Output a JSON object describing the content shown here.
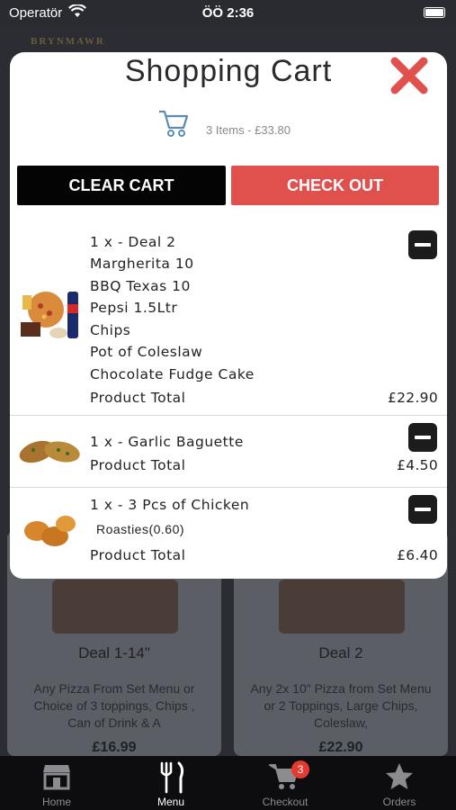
{
  "status_bar": {
    "carrier": "Operatör",
    "time": "ÖÖ 2:36"
  },
  "background": {
    "logo_text": "BRYNMAWR",
    "cards": [
      {
        "title": "Deal 1-14\"",
        "description": "Any Pizza From Set Menu or Choice of 3 toppings, Chips , Can of Drink & A",
        "price": "£16.99"
      },
      {
        "title": "Deal 2",
        "description": "Any 2x 10\" Pizza from Set Menu or 2 Toppings, Large Chips, Coleslaw,",
        "price": "£22.90"
      }
    ]
  },
  "cart": {
    "title": "Shopping Cart",
    "summary": "3 Items - £33.80",
    "clear_label": "CLEAR CART",
    "checkout_label": "CHECK OUT",
    "total_label": "Product Total",
    "items": [
      {
        "lines": [
          "1 x - Deal 2",
          "Margherita 10",
          "BBQ Texas 10",
          "Pepsi 1.5Ltr",
          "Chips",
          "Pot of Coleslaw",
          "Chocolate Fudge Cake"
        ],
        "total": "£22.90"
      },
      {
        "lines": [
          "1 x - Garlic Baguette"
        ],
        "total": "£4.50"
      },
      {
        "lines": [
          "1 x - 3 Pcs of Chicken",
          "Roasties(0.60)"
        ],
        "total": "£6.40"
      }
    ]
  },
  "tabs": [
    {
      "label": "Home",
      "icon": "store-icon"
    },
    {
      "label": "Menu",
      "icon": "fork-knife-icon"
    },
    {
      "label": "Checkout",
      "icon": "cart-icon",
      "badge": "3"
    },
    {
      "label": "Orders",
      "icon": "star-icon"
    }
  ],
  "colors": {
    "accent": "#e0514d",
    "close": "#e0514d",
    "dark_button": "#040404",
    "badge": "#e53a2f"
  }
}
